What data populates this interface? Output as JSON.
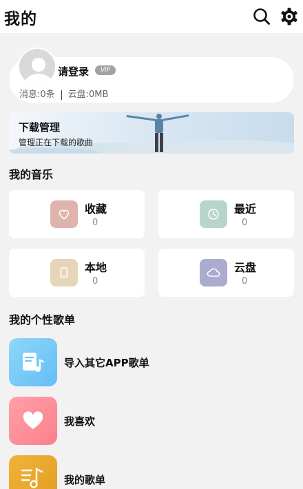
{
  "header": {
    "title": "我的",
    "search_icon": "search-icon",
    "settings_icon": "gear-icon"
  },
  "profile": {
    "login_label": "请登录",
    "vip_badge": "VIP",
    "messages": "消息:0条",
    "cloud": "云盘:0MB"
  },
  "banner": {
    "title": "下载管理",
    "subtitle": "管理正在下载的歌曲"
  },
  "my_music": {
    "title": "我的音乐",
    "tiles": [
      {
        "label": "收藏",
        "count": "0",
        "icon": "heart-icon",
        "color": "#dfb4ad"
      },
      {
        "label": "最近",
        "count": "0",
        "icon": "clock-icon",
        "color": "#b8d5cc"
      },
      {
        "label": "本地",
        "count": "0",
        "icon": "phone-icon",
        "color": "#e5d6b8"
      },
      {
        "label": "云盘",
        "count": "0",
        "icon": "cloud-icon",
        "color": "#ababd0"
      }
    ]
  },
  "playlists": {
    "title": "我的个性歌单",
    "items": [
      {
        "label": "导入其它APP歌单",
        "icon": "music-doc-icon",
        "color": "#7ecff8"
      },
      {
        "label": "我喜欢",
        "icon": "heart-icon",
        "color": "#ff909a"
      },
      {
        "label": "我的歌单",
        "icon": "playlist-icon",
        "color": "#e8a92f"
      }
    ]
  }
}
